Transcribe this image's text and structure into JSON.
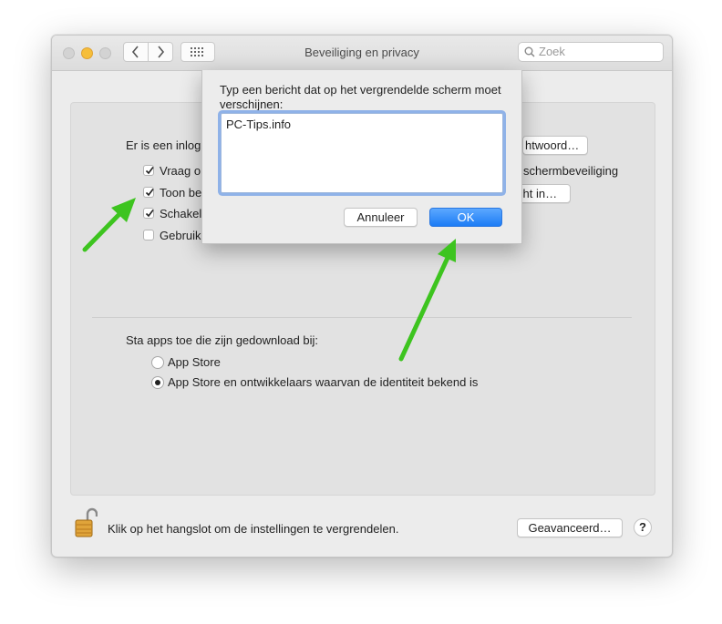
{
  "window": {
    "title": "Beveiliging en privacy",
    "search_placeholder": "Zoek"
  },
  "general": {
    "login_partial": "Er is een inlog",
    "password_button_partial": "htwoord…",
    "options": [
      {
        "label": "Vraag o",
        "checked": true
      },
      {
        "label": "Toon be",
        "checked": true
      },
      {
        "label": "Schakel",
        "checked": true
      },
      {
        "label": "Gebruik",
        "checked": false
      }
    ],
    "screensaver_partial": "schermbeveiliging",
    "message_button_partial": "cht in…"
  },
  "downloads": {
    "heading": "Sta apps toe die zijn gedownload bij:",
    "options": [
      {
        "label": "App Store",
        "selected": false
      },
      {
        "label": "App Store en ontwikkelaars waarvan de identiteit bekend is",
        "selected": true
      }
    ]
  },
  "footer": {
    "lock_text": "Klik op het hangslot om de instellingen te vergrendelen.",
    "advanced_button": "Geavanceerd…",
    "help": "?"
  },
  "dialog": {
    "prompt": "Typ een bericht dat op het vergrendelde scherm moet verschijnen:",
    "message_value": "PC-Tips.info",
    "cancel_button": "Annuleer",
    "ok_button": "OK"
  },
  "colors": {
    "accent": "#1c7cf5",
    "arrow": "#3dc41f",
    "minimize": "#f6be3a"
  }
}
